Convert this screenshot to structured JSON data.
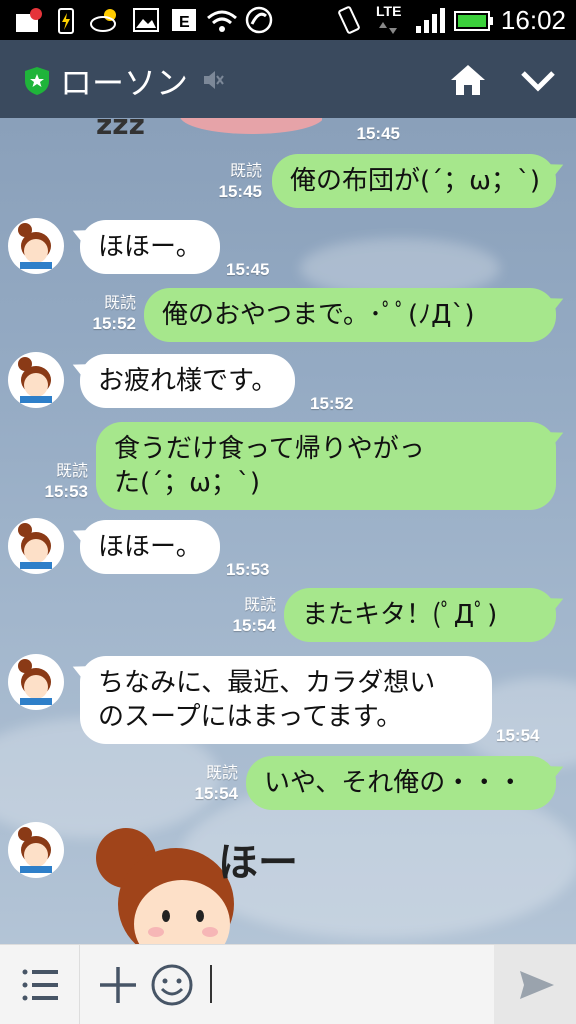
{
  "statusbar": {
    "time": "16:02",
    "network": "LTE",
    "icons": [
      "notification-icon",
      "battery-saver-icon",
      "weather-icon",
      "gallery-icon",
      "email-icon",
      "wifi-icon",
      "sync-icon",
      "rotation-icon",
      "signal-icon",
      "battery-icon"
    ]
  },
  "header": {
    "title": "ローソン",
    "icons": [
      "official-shield-icon",
      "mute-icon",
      "home-icon",
      "chevron-down-icon"
    ]
  },
  "colors": {
    "header_bg": "#3a4a5e",
    "my_bubble": "#a6e78c",
    "their_bubble": "#ffffff",
    "shield": "#1fb43a"
  },
  "messages": [
    {
      "sender": "me",
      "text": "",
      "read_label": "",
      "time": "15:45",
      "sticker": true
    },
    {
      "sender": "me",
      "lines": [
        "俺の布団が(´；ω；`)"
      ],
      "read_label": "既読",
      "time": "15:45"
    },
    {
      "sender": "them",
      "lines": [
        "ほほー。"
      ],
      "time": "15:45"
    },
    {
      "sender": "me",
      "lines": [
        "俺のおやつまで。･ﾟﾟ(ﾉД`)"
      ],
      "read_label": "既読",
      "time": "15:52"
    },
    {
      "sender": "them",
      "lines": [
        "お疲れ様です。"
      ],
      "time": "15:52"
    },
    {
      "sender": "me",
      "lines": [
        "食うだけ食って帰りやがっ",
        "た(´；ω；`)"
      ],
      "read_label": "既読",
      "time": "15:53"
    },
    {
      "sender": "them",
      "lines": [
        "ほほー。"
      ],
      "time": "15:53"
    },
    {
      "sender": "me",
      "lines": [
        "またキタ！(ﾟДﾟ)"
      ],
      "read_label": "既読",
      "time": "15:54"
    },
    {
      "sender": "them",
      "lines": [
        "ちなみに、最近、カラダ想い",
        "のスープにはまってます。"
      ],
      "time": "15:54"
    },
    {
      "sender": "me",
      "lines": [
        "いや、それ俺の・・・"
      ],
      "read_label": "既読",
      "time": "15:54"
    },
    {
      "sender": "them",
      "sticker_text": "ほー"
    }
  ],
  "avatar_label": "LAWSON",
  "inputbar": {
    "icons": [
      "menu-icon",
      "plus-icon",
      "emoji-icon",
      "send-icon"
    ]
  }
}
